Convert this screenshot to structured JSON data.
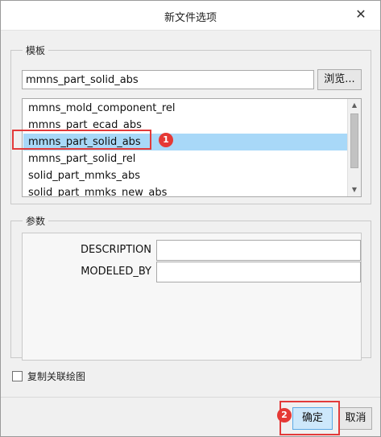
{
  "dialog": {
    "title": "新文件选项",
    "close_glyph": "✕"
  },
  "template_section": {
    "label": "模板",
    "input_value": "mmns_part_solid_abs",
    "browse_label": "浏览...",
    "list_items": [
      {
        "label": "mmns_mold_component_rel",
        "selected": false
      },
      {
        "label": "mmns_part_ecad_abs",
        "selected": false
      },
      {
        "label": "mmns_part_solid_abs",
        "selected": true
      },
      {
        "label": "mmns_part_solid_rel",
        "selected": false
      },
      {
        "label": "solid_part_mmks_abs",
        "selected": false
      },
      {
        "label": "solid_part_mmks_new_abs",
        "selected": false
      }
    ]
  },
  "parameters_section": {
    "label": "参数",
    "rows": [
      {
        "name": "DESCRIPTION",
        "value": ""
      },
      {
        "name": "MODELED_BY",
        "value": ""
      }
    ]
  },
  "copy_drawing": {
    "label": "复制关联绘图",
    "checked": false
  },
  "buttons": {
    "ok_label": "确定",
    "cancel_label": "取消"
  },
  "annotations": {
    "step1": "1",
    "step2": "2",
    "highlight_color": "#e23a3a"
  }
}
